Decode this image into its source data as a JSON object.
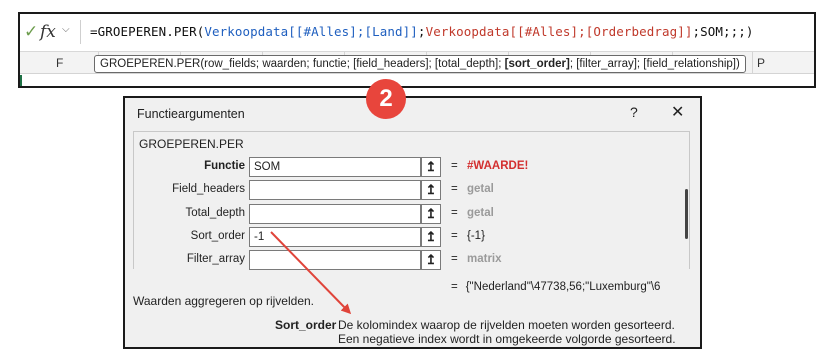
{
  "excel": {
    "check_icon": "check-icon",
    "fx_label": "fx",
    "formula_parts": [
      {
        "text": "=GROEPEREN.PER(",
        "color": "default"
      },
      {
        "text": "Verkoopdata[[#Alles];[Land]]",
        "color": "blue"
      },
      {
        "text": ";",
        "color": "default"
      },
      {
        "text": "Verkoopdata[[#Alles];[Orderbedrag]]",
        "color": "red"
      },
      {
        "text": ";SOM;;;)",
        "color": "default"
      }
    ],
    "column_F": "F",
    "column_P": "P",
    "tooltip_pre": "GROEPEREN.PER(row_fields; waarden; functie; [field_headers]; [total_depth]; ",
    "tooltip_bold": "[sort_order]",
    "tooltip_post": "; [filter_array]; [field_relationship])"
  },
  "badge": "2",
  "dialog": {
    "title": "Functieargumenten",
    "help": "?",
    "close": "✕",
    "function_name": "GROEPEREN.PER",
    "args": [
      {
        "label": "Functie",
        "value": "SOM",
        "eq": "=",
        "result": "#WAARDE!",
        "result_style": "err",
        "bold": true
      },
      {
        "label": "Field_headers",
        "value": "",
        "eq": "=",
        "result": "getal",
        "result_style": "gray",
        "bold": false
      },
      {
        "label": "Total_depth",
        "value": "",
        "eq": "=",
        "result": "getal",
        "result_style": "gray",
        "bold": false
      },
      {
        "label": "Sort_order",
        "value": "-1",
        "eq": "=",
        "result": "{-1}",
        "result_style": "dark",
        "bold": false
      },
      {
        "label": "Filter_array",
        "value": "",
        "eq": "=",
        "result": "matrix",
        "result_style": "gray",
        "bold": false
      }
    ],
    "ref_button_icon": "↥",
    "overall_eq": "=",
    "overall_result": "{\"Nederland\"\\47738,56;\"Luxemburg\"\\6",
    "description": "Waarden aggregeren op rijvelden.",
    "sort_label": "Sort_order",
    "sort_help": "De kolomindex waarop de rijvelden moeten worden gesorteerd. Een negatieve index wordt in omgekeerde volgorde gesorteerd."
  },
  "colors": {
    "badge": "#e8453c",
    "arrow": "#e0443a",
    "formula_blue": "#1f5fbf",
    "formula_red": "#c0392b",
    "error_red": "#d32f2f"
  }
}
